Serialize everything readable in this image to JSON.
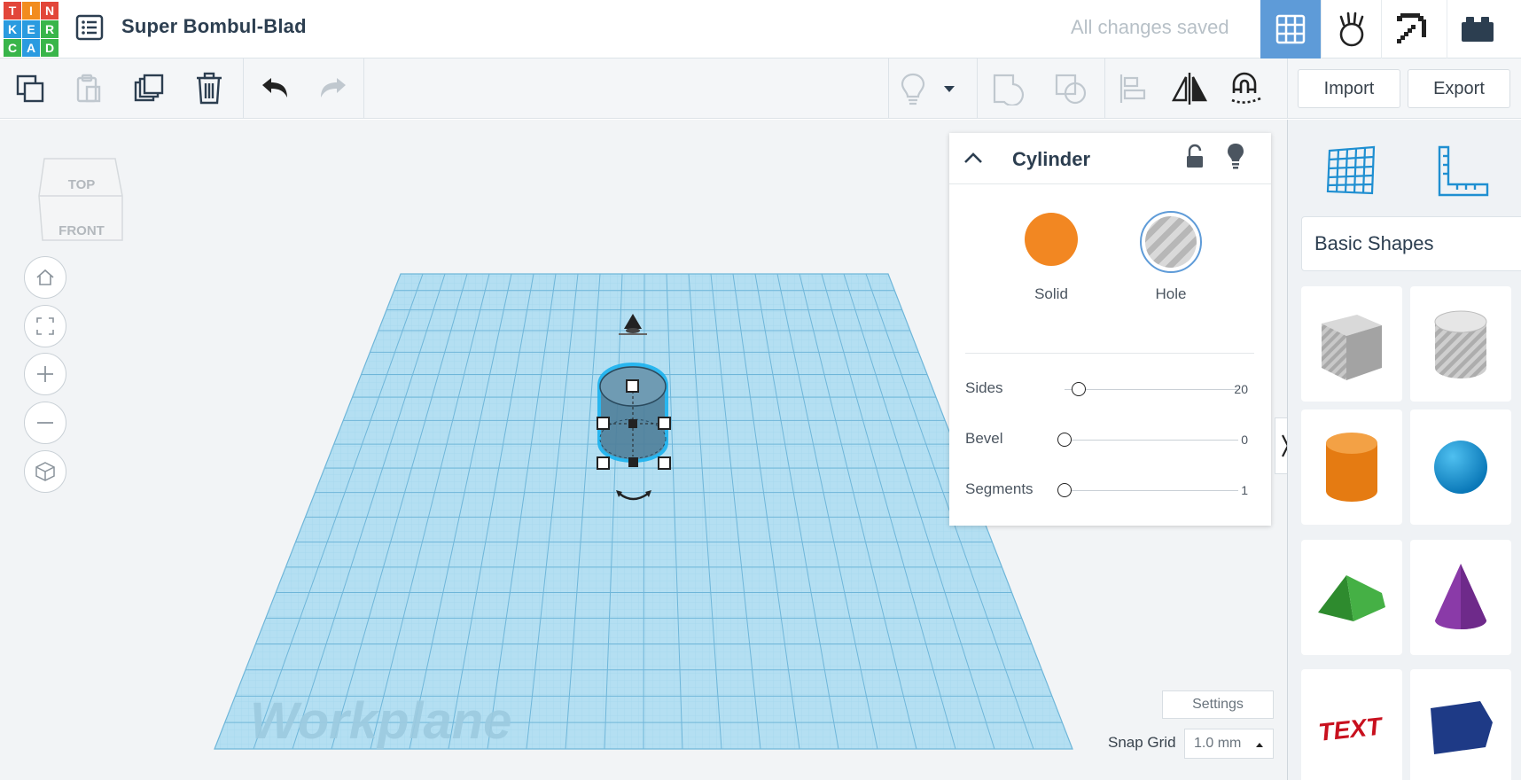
{
  "app": {
    "logo_letters": [
      "T",
      "I",
      "N",
      "K",
      "E",
      "R",
      "C",
      "A",
      "D"
    ],
    "design_title": "Super Bombul-Blad",
    "save_status": "All changes saved",
    "brand_colors": [
      "#e2463a",
      "#f28c1f",
      "#e2463a",
      "#2a9be0",
      "#2a9be0",
      "#39b54a",
      "#39b54a",
      "#2a9be0",
      "#39b54a"
    ],
    "accent": "#5e9bd8"
  },
  "top_tabs": [
    {
      "name": "3d-view-grid-icon",
      "active": true
    },
    {
      "name": "simulation-hand-icon",
      "active": false
    },
    {
      "name": "minecraft-pickaxe-icon",
      "active": false
    },
    {
      "name": "bricks-icon",
      "active": false
    }
  ],
  "toolbar": {
    "icons": [
      "copy-icon",
      "paste-icon",
      "duplicate-icon",
      "delete-icon",
      "undo-icon",
      "redo-icon",
      "lightbulb-icon",
      "dropdown-arrow-icon",
      "group-icon",
      "ungroup-icon",
      "align-icon",
      "mirror-icon",
      "magnet-icon"
    ],
    "import_label": "Import",
    "export_label": "Export"
  },
  "viewcube": {
    "top_label": "TOP",
    "front_label": "FRONT"
  },
  "nav_buttons": [
    "home-icon",
    "fit-view-icon",
    "zoom-in-icon",
    "zoom-out-icon",
    "perspective-icon"
  ],
  "workplane": {
    "label": "Workplane",
    "color": "#a8d8f0"
  },
  "inspector": {
    "title": "Cylinder",
    "solid_label": "Solid",
    "hole_label": "Hole",
    "solid_color": "#f28722",
    "properties": [
      {
        "label": "Sides",
        "value": "20",
        "fraction": 0.08
      },
      {
        "label": "Bevel",
        "value": "0",
        "fraction": 0.0
      },
      {
        "label": "Segments",
        "value": "1",
        "fraction": 0.0
      }
    ]
  },
  "viewport_controls": {
    "settings_label": "Settings",
    "snap_grid_label": "Snap Grid",
    "snap_grid_value": "1.0 mm"
  },
  "right_panel": {
    "tools": [
      "workplane-tool-icon",
      "ruler-tool-icon"
    ],
    "category_label": "Basic Shapes",
    "shapes": [
      "box-hole",
      "cylinder-hole",
      "cylinder",
      "sphere",
      "roof",
      "cone",
      "text",
      "polygon"
    ]
  }
}
